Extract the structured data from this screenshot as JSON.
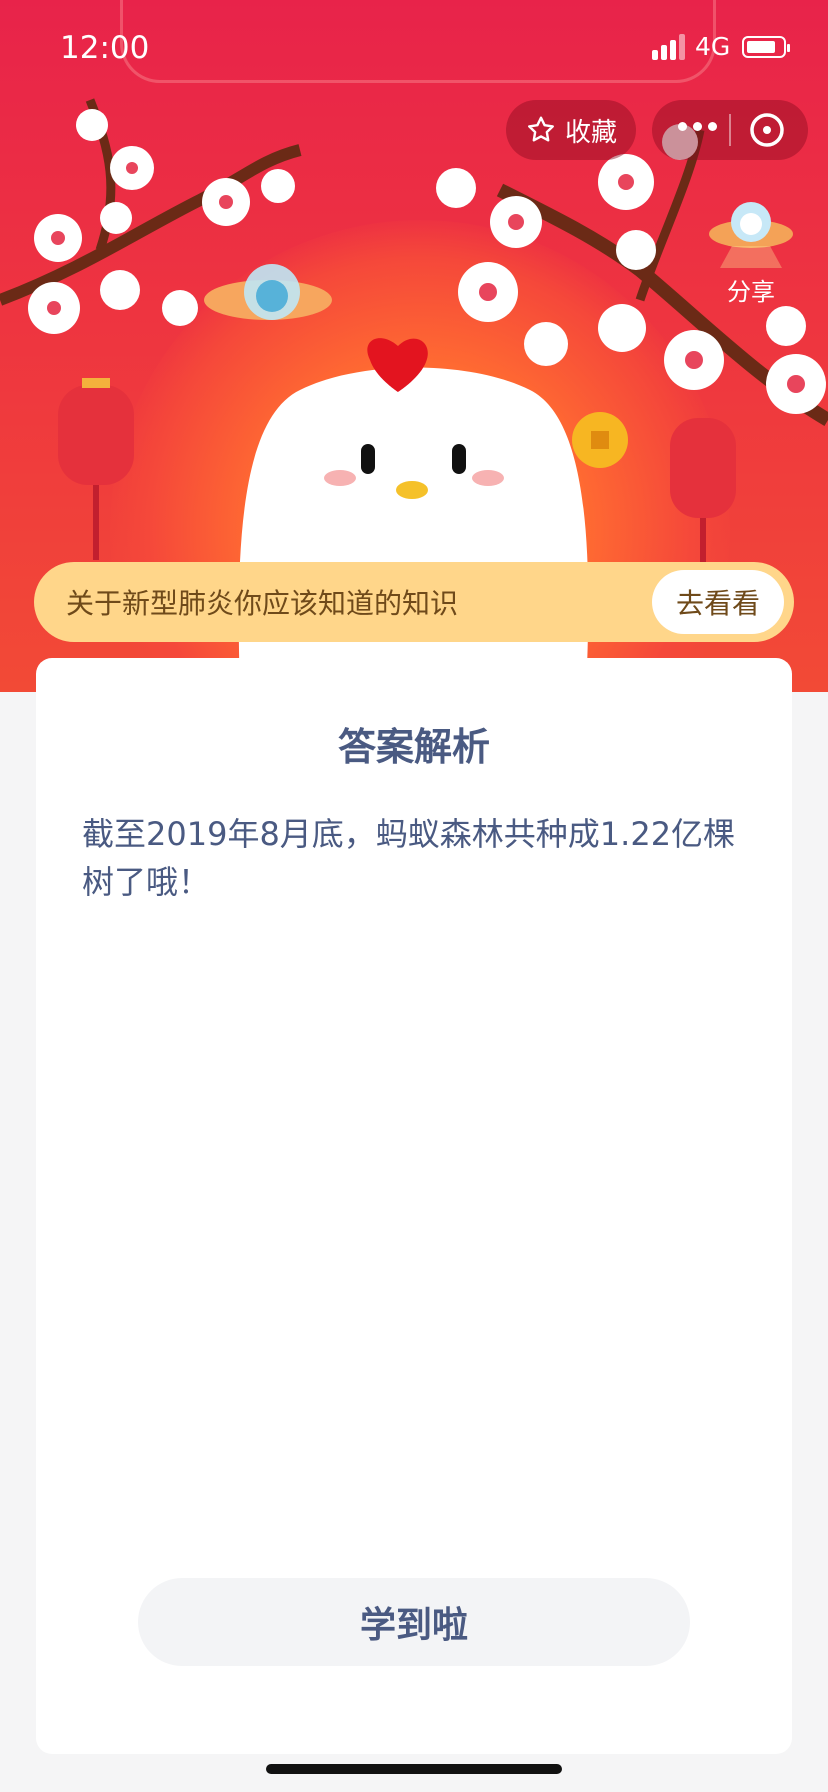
{
  "status_bar": {
    "time": "12:00",
    "network": "4G"
  },
  "top_actions": {
    "favorite_label": "收藏",
    "share_label": "分享"
  },
  "banner": {
    "text": "关于新型肺炎你应该知道的知识",
    "button": "去看看"
  },
  "card": {
    "title": "答案解析",
    "body": "截至2019年8月底，蚂蚁森林共种成1.22亿棵树了哦！",
    "button": "学到啦"
  },
  "colors": {
    "hero_top": "#e8234a",
    "hero_bottom": "#f24a36",
    "banner_bg": "#ffd68a",
    "text_primary": "#4a5a82",
    "page_bg": "#f5f5f6"
  }
}
